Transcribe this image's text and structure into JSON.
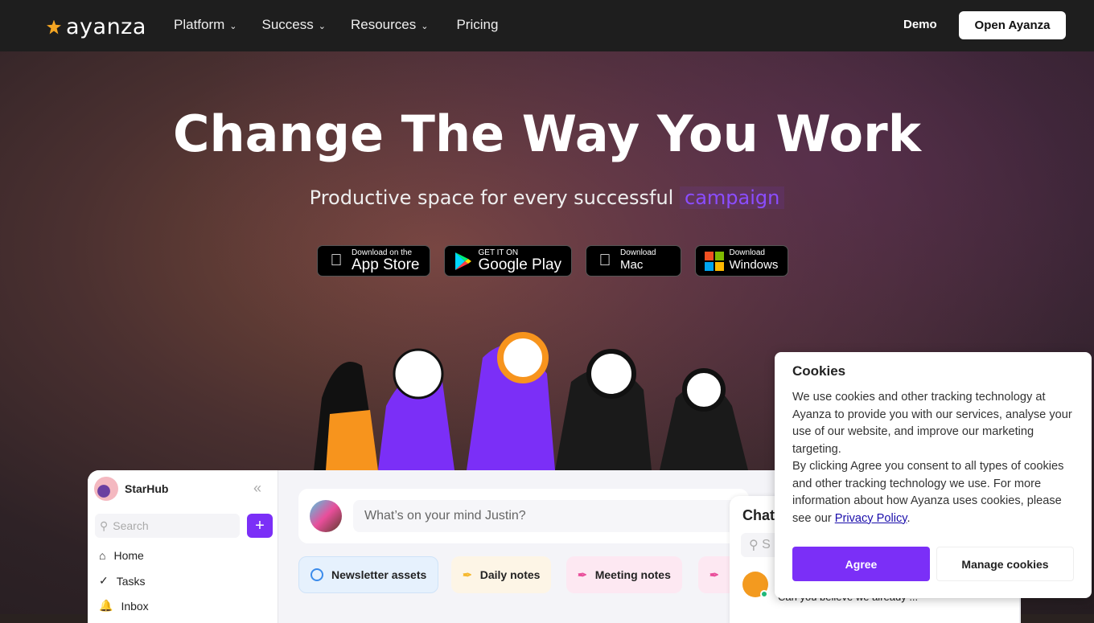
{
  "nav": {
    "logo": "ayanza",
    "items": [
      {
        "label": "Platform",
        "dropdown": true
      },
      {
        "label": "Success",
        "dropdown": true
      },
      {
        "label": "Resources",
        "dropdown": true
      },
      {
        "label": "Pricing",
        "dropdown": false
      }
    ],
    "demo": "Demo",
    "open": "Open Ayanza"
  },
  "hero": {
    "title": "Change The Way You Work",
    "subtitle": "Productive space for every successful",
    "highlight": "campaign",
    "badges": [
      {
        "small": "Download on the",
        "big": "App Store",
        "icon": "apple-icon"
      },
      {
        "small": "GET IT ON",
        "big": "Google Play",
        "icon": "google-play-icon"
      },
      {
        "small": "Download",
        "big": "Mac",
        "icon": "apple-icon"
      },
      {
        "small": "Download",
        "big": "Windows",
        "icon": "windows-icon"
      }
    ]
  },
  "app": {
    "workspace": "StarHub",
    "search": "Search",
    "sidebar": [
      "Home",
      "Tasks",
      "Inbox"
    ],
    "post_placeholder": "What’s on your mind Justin?",
    "chips": [
      "Newsletter assets",
      "Daily notes",
      "Meeting notes"
    ],
    "chat_title": "Chat",
    "chat_search": "S",
    "chat_message": "Can you believe we already ..."
  },
  "cookies": {
    "title": "Cookies",
    "p1": "We use cookies and other tracking technology at Ayanza to provide you with our services, analyse your use of our website, and improve our marketing targeting.",
    "p2": "By clicking Agree you consent to all types of cookies and other tracking technology we use. For more information about how Ayanza uses cookies, please see our ",
    "link": "Privacy Policy",
    "p2_end": ".",
    "agree": "Agree",
    "manage": "Manage cookies"
  },
  "colors": {
    "accent": "#7b2ff7",
    "nav_bg": "#1e1e1e"
  }
}
